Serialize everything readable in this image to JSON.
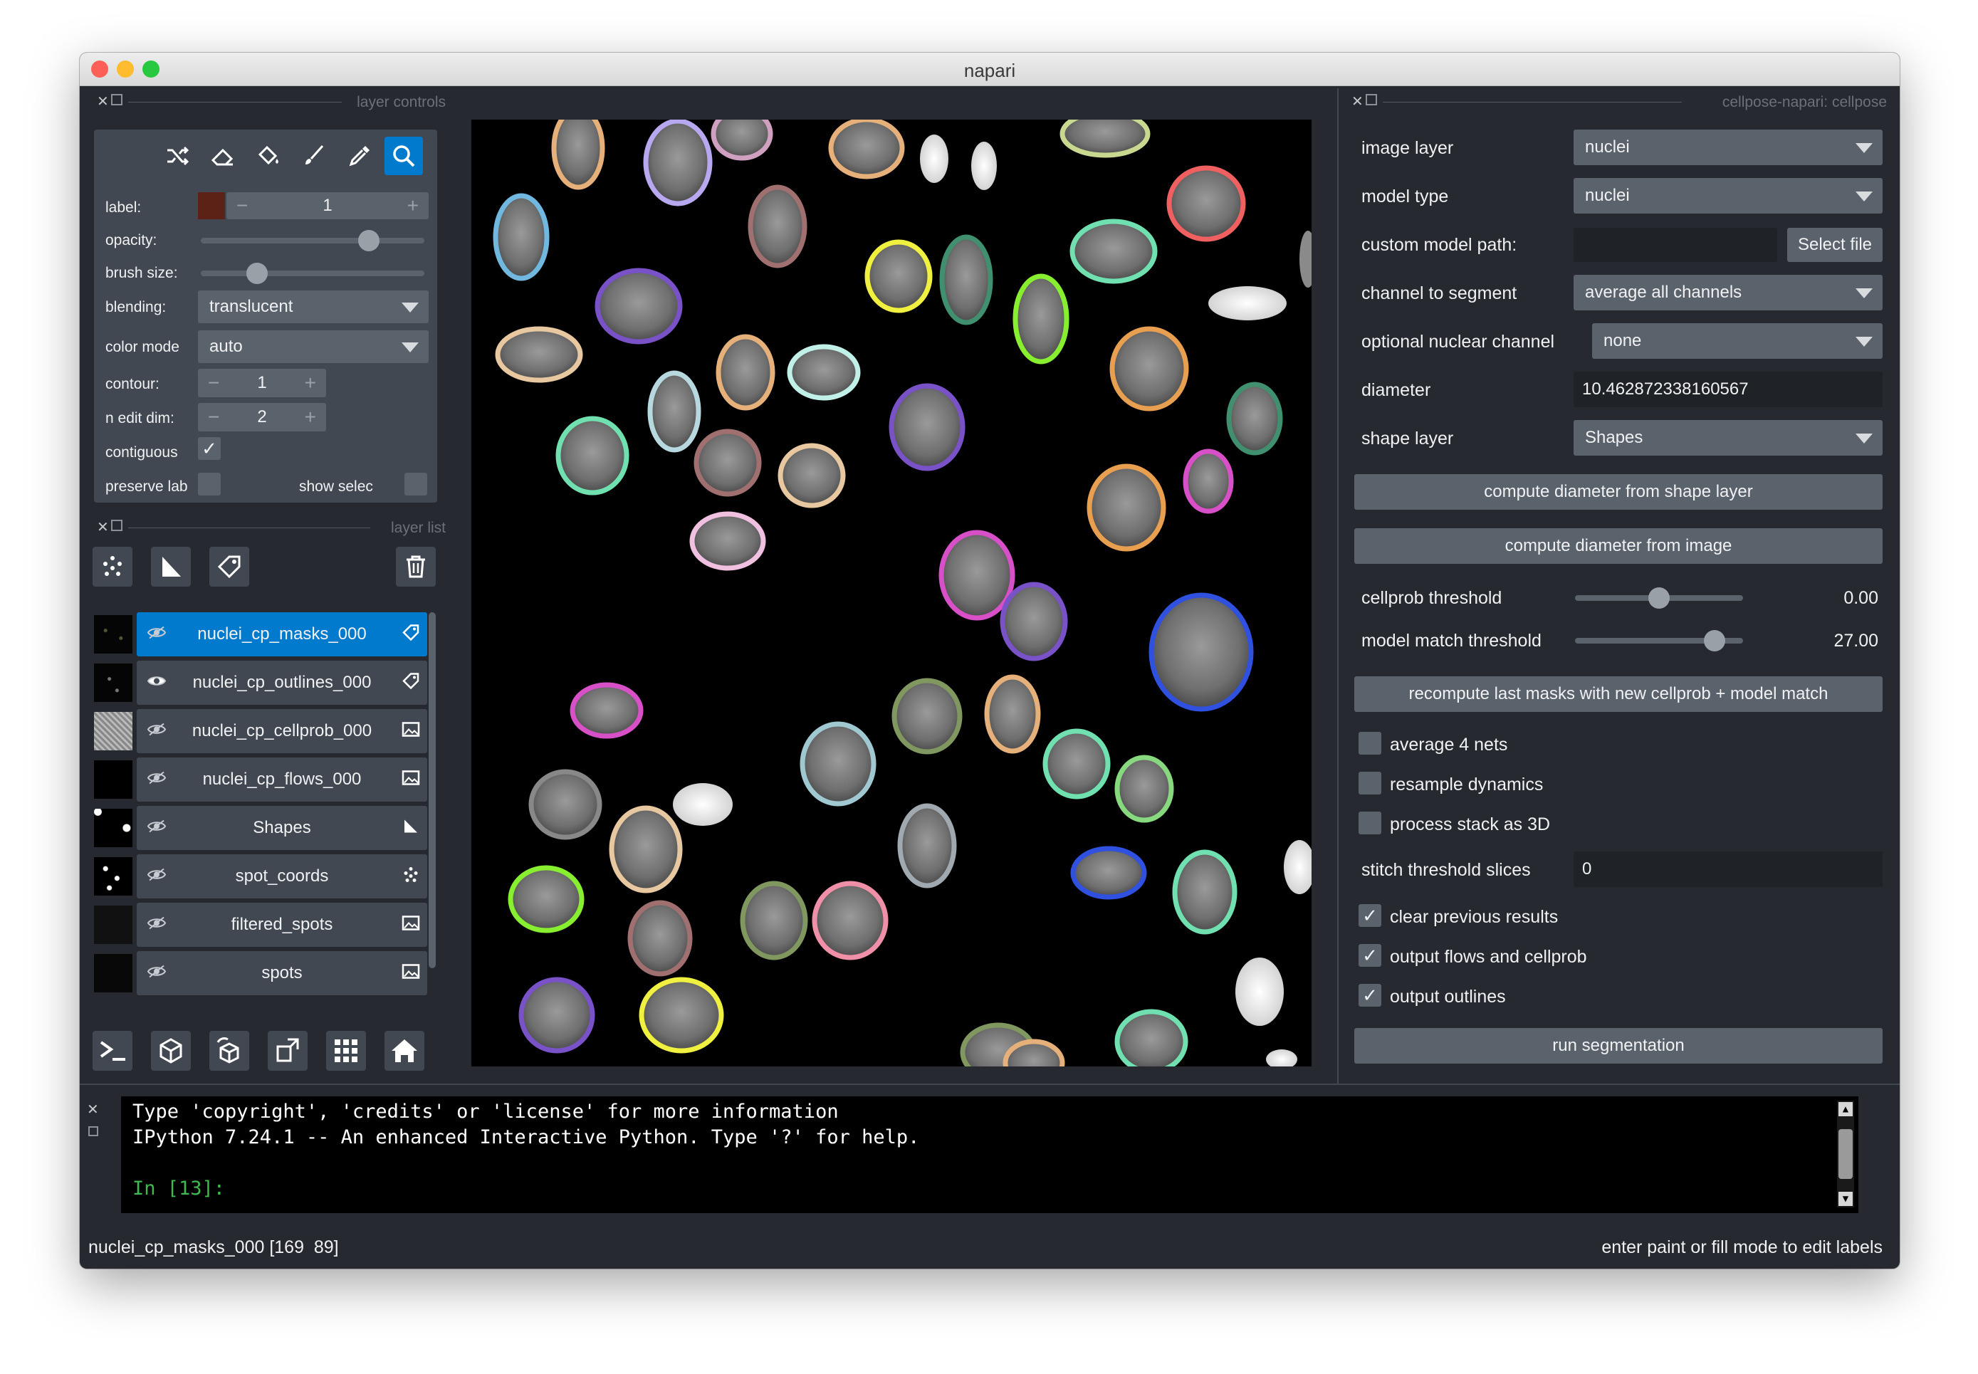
{
  "window": {
    "title": "napari"
  },
  "layer_controls": {
    "dock_title": "layer controls",
    "label_label": "label:",
    "label_value": "1",
    "opacity_label": "opacity:",
    "opacity_value": 0.75,
    "brush_size_label": "brush size:",
    "brush_size_value": 0.25,
    "blending_label": "blending:",
    "blending_value": "translucent",
    "color_mode_label": "color mode",
    "color_mode_value": "auto",
    "contour_label": "contour:",
    "contour_value": "1",
    "n_edit_dim_label": "n edit dim:",
    "n_edit_dim_value": "2",
    "contiguous_label": "contiguous",
    "contiguous_checked": true,
    "preserve_label": "preserve lab",
    "preserve_checked": false,
    "show_selected_label": "show selec",
    "show_selected_checked": false,
    "label_color": "#5c2216",
    "tools": [
      "shuffle-icon",
      "eraser-icon",
      "fill-bucket-icon",
      "paintbrush-icon",
      "eyedropper-icon",
      "zoom-icon"
    ],
    "active_tool": "zoom-icon"
  },
  "layer_list": {
    "dock_title": "layer list",
    "layers": [
      {
        "name": "nuclei_cp_masks_000",
        "type": "labels",
        "selected": true
      },
      {
        "name": "nuclei_cp_outlines_000",
        "type": "labels",
        "selected": false
      },
      {
        "name": "nuclei_cp_cellprob_000",
        "type": "image",
        "selected": false
      },
      {
        "name": "nuclei_cp_flows_000",
        "type": "image",
        "selected": false
      },
      {
        "name": "Shapes",
        "type": "shapes",
        "selected": false
      },
      {
        "name": "spot_coords",
        "type": "points",
        "selected": false
      },
      {
        "name": "filtered_spots",
        "type": "image",
        "selected": false
      },
      {
        "name": "spots",
        "type": "image",
        "selected": false
      }
    ]
  },
  "cellpose": {
    "dock_title": "cellpose-napari: cellpose",
    "image_layer_label": "image layer",
    "image_layer_value": "nuclei",
    "model_type_label": "model type",
    "model_type_value": "nuclei",
    "custom_model_label": "custom model path:",
    "custom_model_value": "",
    "select_file_label": "Select file",
    "channel_label": "channel to segment",
    "channel_value": "average all channels",
    "nuclear_channel_label": "optional nuclear channel",
    "nuclear_channel_value": "none",
    "diameter_label": "diameter",
    "diameter_value": "10.462872338160567",
    "shape_layer_label": "shape layer",
    "shape_layer_value": "Shapes",
    "compute_shape_button": "compute diameter from shape layer",
    "compute_image_button": "compute diameter from image",
    "cellprob_label": "cellprob threshold",
    "cellprob_value": "0.00",
    "cellprob_fraction": 0.5,
    "model_match_label": "model match threshold",
    "model_match_value": "27.00",
    "model_match_fraction": 0.83,
    "recompute_button": "recompute last masks with new cellprob + model match",
    "average4_label": "average 4 nets",
    "average4_checked": false,
    "resample_label": "resample dynamics",
    "resample_checked": false,
    "process3d_label": "process stack as 3D",
    "process3d_checked": false,
    "stitch_label": "stitch threshold slices",
    "stitch_value": "0",
    "clear_label": "clear previous results",
    "clear_checked": true,
    "output_flows_label": "output flows and cellprob",
    "output_flows_checked": true,
    "output_outlines_label": "output outlines",
    "output_outlines_checked": true,
    "run_button": "run segmentation"
  },
  "console": {
    "line1": "Type 'copyright', 'credits' or 'license' for more information",
    "line2": "IPython 7.24.1 -- An enhanced Interactive Python. Type '?' for help.",
    "prompt": "In [13]:"
  },
  "status": {
    "left": "nuclei_cp_masks_000 [169  89]",
    "right": "enter paint or fill mode to edit labels"
  },
  "colors": {
    "accent": "#007acc",
    "background": "#262930",
    "panel": "#414851",
    "prompt": "#3fb950"
  }
}
